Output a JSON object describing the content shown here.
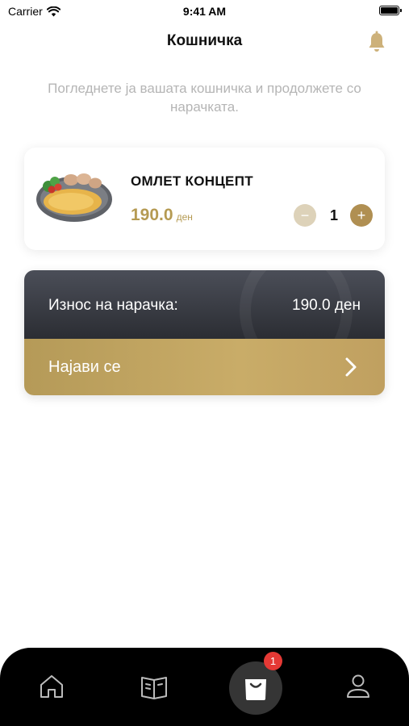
{
  "status_bar": {
    "carrier": "Carrier",
    "time": "9:41 AM"
  },
  "header": {
    "title": "Кошничка"
  },
  "subtitle": "Погледнете ја вашата кошничка и продолжете со нарачката.",
  "cart": {
    "items": [
      {
        "name": "ОМЛЕТ КОНЦЕПТ",
        "price": "190.0",
        "currency": "ден",
        "quantity": "1"
      }
    ],
    "minus_symbol": "−",
    "plus_symbol": "+"
  },
  "order": {
    "total_label": "Износ на нарачка:",
    "total_value": "190.0 ден",
    "login_label": "Најави се"
  },
  "tab_bar": {
    "tabs": [
      {
        "icon": "home-icon"
      },
      {
        "icon": "book-menu-icon"
      },
      {
        "icon": "shopping-bag-icon"
      },
      {
        "icon": "profile-icon"
      }
    ],
    "cart_badge": "1"
  },
  "colors": {
    "accent_gold": "#b59a52",
    "dark_panel": "#2b2d33",
    "badge_red": "#e53935"
  }
}
